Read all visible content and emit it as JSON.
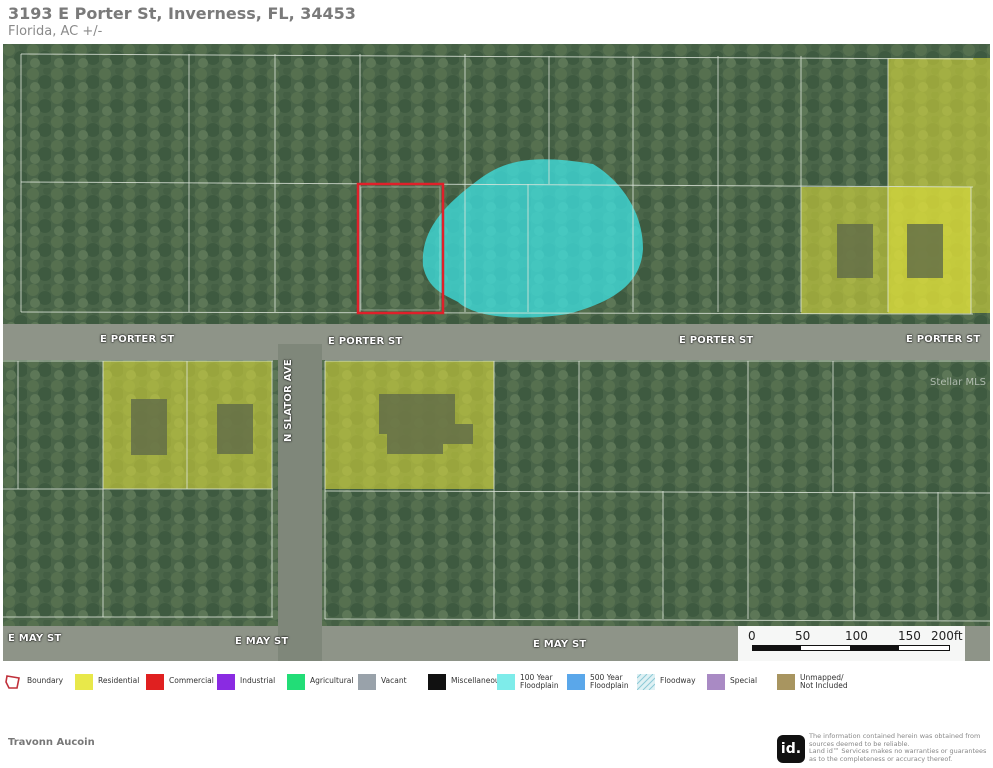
{
  "header": {
    "title": "3193 E Porter St, Inverness, FL, 34453",
    "subtitle": "Florida,  AC +/-"
  },
  "map": {
    "streets": [
      {
        "id": "e-porter-st-1",
        "label": "E PORTER ST"
      },
      {
        "id": "e-porter-st-2",
        "label": "E PORTER ST"
      },
      {
        "id": "e-porter-st-3",
        "label": "E PORTER ST"
      },
      {
        "id": "e-porter-st-4",
        "label": "E PORTER ST"
      },
      {
        "id": "n-slator-ave",
        "label": "N SLATOR AVE"
      },
      {
        "id": "e-may-st-1",
        "label": "E MAY ST"
      },
      {
        "id": "e-may-st-2",
        "label": "E MAY ST"
      },
      {
        "id": "e-may-st-3",
        "label": "E MAY ST"
      }
    ],
    "watermark": "Stellar MLS",
    "colors": {
      "residential": "#e3e33a",
      "floodplain": "#3fe3e3",
      "boundary": "#e0202a",
      "parcel_line": "#dfe6dc"
    }
  },
  "scale": {
    "labels": [
      "0",
      "50",
      "100",
      "150",
      "200ft"
    ]
  },
  "legend": [
    {
      "label": "Boundary",
      "color": "#c0303a",
      "icon": "boundary-outline"
    },
    {
      "label": "Residential",
      "color": "#e8e84a"
    },
    {
      "label": "Commercial",
      "color": "#e02020"
    },
    {
      "label": "Industrial",
      "color": "#8a2be2"
    },
    {
      "label": "Agricultural",
      "color": "#22dd77"
    },
    {
      "label": "Vacant",
      "color": "#99a2aa"
    },
    {
      "label": "Miscellaneou",
      "color": "#111111"
    },
    {
      "label": "100 Year\nFloodplain",
      "color": "#7eecea"
    },
    {
      "label": "500 Year\nFloodplain",
      "color": "#5aa7ea"
    },
    {
      "label": "Floodway",
      "color": "#bfe2ea",
      "icon": "hatched"
    },
    {
      "label": "Special",
      "color": "#a98ac4"
    },
    {
      "label": "Unmapped/\nNot Included",
      "color": "#a89560"
    }
  ],
  "footer": {
    "agent": "Travonn Aucoin",
    "logo_text": "id.",
    "disclaimer": "The information contained herein was obtained from\nsources deemed to be reliable.\nLand id™ Services makes no warranties or guarantees\nas to the completeness or accuracy thereof."
  }
}
